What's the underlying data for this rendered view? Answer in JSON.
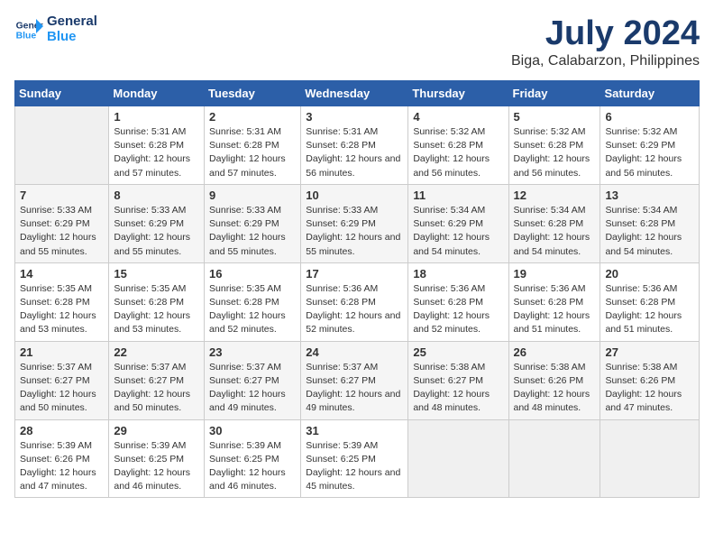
{
  "header": {
    "logo_line1": "General",
    "logo_line2": "Blue",
    "month": "July 2024",
    "location": "Biga, Calabarzon, Philippines"
  },
  "days_of_week": [
    "Sunday",
    "Monday",
    "Tuesday",
    "Wednesday",
    "Thursday",
    "Friday",
    "Saturday"
  ],
  "weeks": [
    [
      {
        "day": "",
        "empty": true
      },
      {
        "day": "1",
        "sunrise": "5:31 AM",
        "sunset": "6:28 PM",
        "daylight": "12 hours and 57 minutes."
      },
      {
        "day": "2",
        "sunrise": "5:31 AM",
        "sunset": "6:28 PM",
        "daylight": "12 hours and 57 minutes."
      },
      {
        "day": "3",
        "sunrise": "5:31 AM",
        "sunset": "6:28 PM",
        "daylight": "12 hours and 56 minutes."
      },
      {
        "day": "4",
        "sunrise": "5:32 AM",
        "sunset": "6:28 PM",
        "daylight": "12 hours and 56 minutes."
      },
      {
        "day": "5",
        "sunrise": "5:32 AM",
        "sunset": "6:28 PM",
        "daylight": "12 hours and 56 minutes."
      },
      {
        "day": "6",
        "sunrise": "5:32 AM",
        "sunset": "6:29 PM",
        "daylight": "12 hours and 56 minutes."
      }
    ],
    [
      {
        "day": "7",
        "sunrise": "5:33 AM",
        "sunset": "6:29 PM",
        "daylight": "12 hours and 55 minutes."
      },
      {
        "day": "8",
        "sunrise": "5:33 AM",
        "sunset": "6:29 PM",
        "daylight": "12 hours and 55 minutes."
      },
      {
        "day": "9",
        "sunrise": "5:33 AM",
        "sunset": "6:29 PM",
        "daylight": "12 hours and 55 minutes."
      },
      {
        "day": "10",
        "sunrise": "5:33 AM",
        "sunset": "6:29 PM",
        "daylight": "12 hours and 55 minutes."
      },
      {
        "day": "11",
        "sunrise": "5:34 AM",
        "sunset": "6:29 PM",
        "daylight": "12 hours and 54 minutes."
      },
      {
        "day": "12",
        "sunrise": "5:34 AM",
        "sunset": "6:28 PM",
        "daylight": "12 hours and 54 minutes."
      },
      {
        "day": "13",
        "sunrise": "5:34 AM",
        "sunset": "6:28 PM",
        "daylight": "12 hours and 54 minutes."
      }
    ],
    [
      {
        "day": "14",
        "sunrise": "5:35 AM",
        "sunset": "6:28 PM",
        "daylight": "12 hours and 53 minutes."
      },
      {
        "day": "15",
        "sunrise": "5:35 AM",
        "sunset": "6:28 PM",
        "daylight": "12 hours and 53 minutes."
      },
      {
        "day": "16",
        "sunrise": "5:35 AM",
        "sunset": "6:28 PM",
        "daylight": "12 hours and 52 minutes."
      },
      {
        "day": "17",
        "sunrise": "5:36 AM",
        "sunset": "6:28 PM",
        "daylight": "12 hours and 52 minutes."
      },
      {
        "day": "18",
        "sunrise": "5:36 AM",
        "sunset": "6:28 PM",
        "daylight": "12 hours and 52 minutes."
      },
      {
        "day": "19",
        "sunrise": "5:36 AM",
        "sunset": "6:28 PM",
        "daylight": "12 hours and 51 minutes."
      },
      {
        "day": "20",
        "sunrise": "5:36 AM",
        "sunset": "6:28 PM",
        "daylight": "12 hours and 51 minutes."
      }
    ],
    [
      {
        "day": "21",
        "sunrise": "5:37 AM",
        "sunset": "6:27 PM",
        "daylight": "12 hours and 50 minutes."
      },
      {
        "day": "22",
        "sunrise": "5:37 AM",
        "sunset": "6:27 PM",
        "daylight": "12 hours and 50 minutes."
      },
      {
        "day": "23",
        "sunrise": "5:37 AM",
        "sunset": "6:27 PM",
        "daylight": "12 hours and 49 minutes."
      },
      {
        "day": "24",
        "sunrise": "5:37 AM",
        "sunset": "6:27 PM",
        "daylight": "12 hours and 49 minutes."
      },
      {
        "day": "25",
        "sunrise": "5:38 AM",
        "sunset": "6:27 PM",
        "daylight": "12 hours and 48 minutes."
      },
      {
        "day": "26",
        "sunrise": "5:38 AM",
        "sunset": "6:26 PM",
        "daylight": "12 hours and 48 minutes."
      },
      {
        "day": "27",
        "sunrise": "5:38 AM",
        "sunset": "6:26 PM",
        "daylight": "12 hours and 47 minutes."
      }
    ],
    [
      {
        "day": "28",
        "sunrise": "5:39 AM",
        "sunset": "6:26 PM",
        "daylight": "12 hours and 47 minutes."
      },
      {
        "day": "29",
        "sunrise": "5:39 AM",
        "sunset": "6:25 PM",
        "daylight": "12 hours and 46 minutes."
      },
      {
        "day": "30",
        "sunrise": "5:39 AM",
        "sunset": "6:25 PM",
        "daylight": "12 hours and 46 minutes."
      },
      {
        "day": "31",
        "sunrise": "5:39 AM",
        "sunset": "6:25 PM",
        "daylight": "12 hours and 45 minutes."
      },
      {
        "day": "",
        "empty": true
      },
      {
        "day": "",
        "empty": true
      },
      {
        "day": "",
        "empty": true
      }
    ]
  ]
}
